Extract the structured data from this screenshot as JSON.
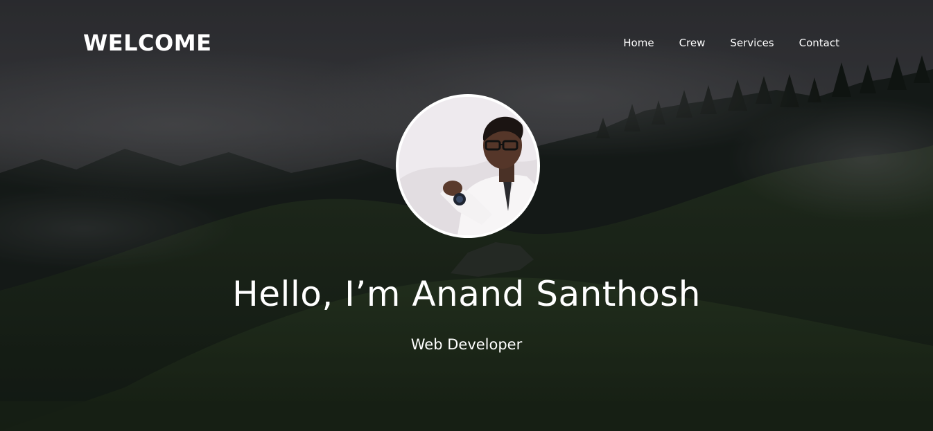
{
  "header": {
    "brand": "WELCOME",
    "nav": [
      {
        "label": "Home"
      },
      {
        "label": "Crew"
      },
      {
        "label": "Services"
      },
      {
        "label": "Contact"
      }
    ]
  },
  "hero": {
    "headline": "Hello, I’m Anand Santhosh",
    "subtitle": "Web Developer"
  },
  "colors": {
    "text": "#ffffff",
    "overlay": "#2b2d33",
    "forest": "#1f2a1d"
  },
  "icons": {
    "avatar": "profile-photo"
  }
}
